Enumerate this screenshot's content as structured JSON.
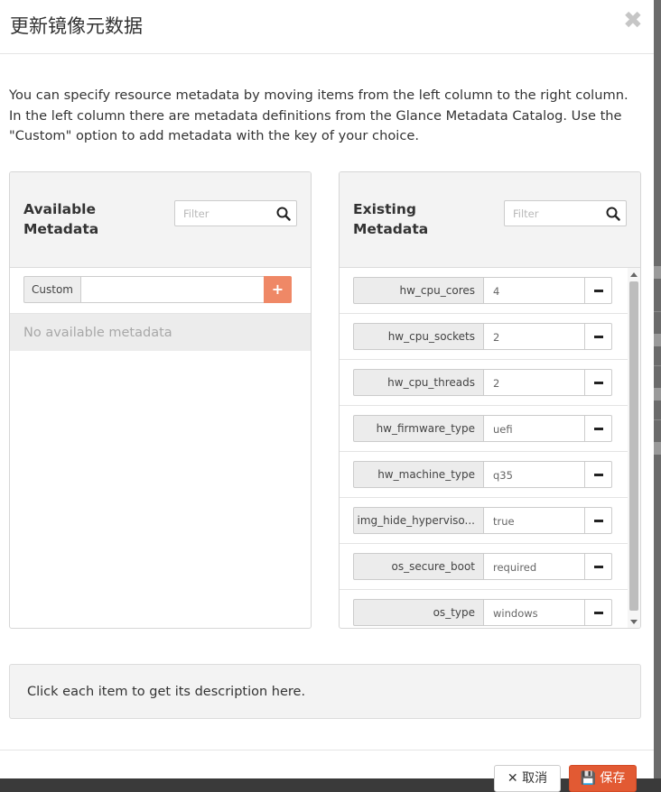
{
  "modal": {
    "title": "更新镜像元数据",
    "close_glyph": "✖",
    "intro": "You can specify resource metadata by moving items from the left column to the right column. In the left column there are metadata definitions from the Glance Metadata Catalog. Use the \"Custom\" option to add metadata with the key of your choice."
  },
  "available": {
    "title": "Available Metadata",
    "filter_placeholder": "Filter",
    "custom_label": "Custom",
    "custom_value": "",
    "add_glyph": "+",
    "empty_text": "No available metadata"
  },
  "existing": {
    "title": "Existing Metadata",
    "filter_placeholder": "Filter",
    "items": [
      {
        "key": "hw_cpu_cores",
        "value": "4"
      },
      {
        "key": "hw_cpu_sockets",
        "value": "2"
      },
      {
        "key": "hw_cpu_threads",
        "value": "2"
      },
      {
        "key": "hw_firmware_type",
        "value": "uefi"
      },
      {
        "key": "hw_machine_type",
        "value": "q35"
      },
      {
        "key": "img_hide_hyperviso...",
        "value": "true"
      },
      {
        "key": "os_secure_boot",
        "value": "required"
      },
      {
        "key": "os_type",
        "value": "windows"
      }
    ]
  },
  "description": "Click each item to get its description here.",
  "footer": {
    "cancel_label": "✕ 取消",
    "save_label": "💾 保存"
  },
  "colors": {
    "accent": "#e25a33",
    "add_button": "#ef8866"
  },
  "icons": {
    "search": "search-icon",
    "close": "close-icon",
    "remove": "minus-icon",
    "add": "plus-icon"
  }
}
